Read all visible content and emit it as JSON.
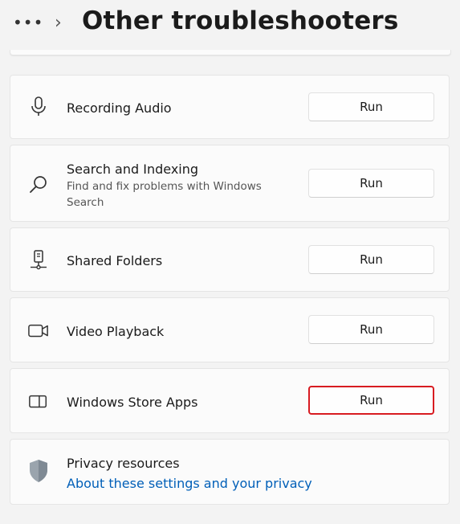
{
  "header": {
    "more_label": "•••",
    "chevron": "›",
    "title": "Other troubleshooters"
  },
  "troubleshooters": [
    {
      "name": "Recording Audio",
      "description": "",
      "icon": "microphone-icon",
      "button": "Run",
      "highlighted": false
    },
    {
      "name": "Search and Indexing",
      "description": "Find and fix problems with Windows Search",
      "icon": "search-icon",
      "button": "Run",
      "highlighted": false
    },
    {
      "name": "Shared Folders",
      "description": "",
      "icon": "shared-folder-icon",
      "button": "Run",
      "highlighted": false
    },
    {
      "name": "Video Playback",
      "description": "",
      "icon": "video-camera-icon",
      "button": "Run",
      "highlighted": false
    },
    {
      "name": "Windows Store Apps",
      "description": "",
      "icon": "store-apps-icon",
      "button": "Run",
      "highlighted": true
    }
  ],
  "privacy": {
    "title": "Privacy resources",
    "link": "About these settings and your privacy",
    "icon": "shield-icon"
  },
  "colors": {
    "highlight": "#d81b21",
    "link": "#005fb8",
    "background": "#f3f3f3",
    "card": "#fbfbfb"
  }
}
